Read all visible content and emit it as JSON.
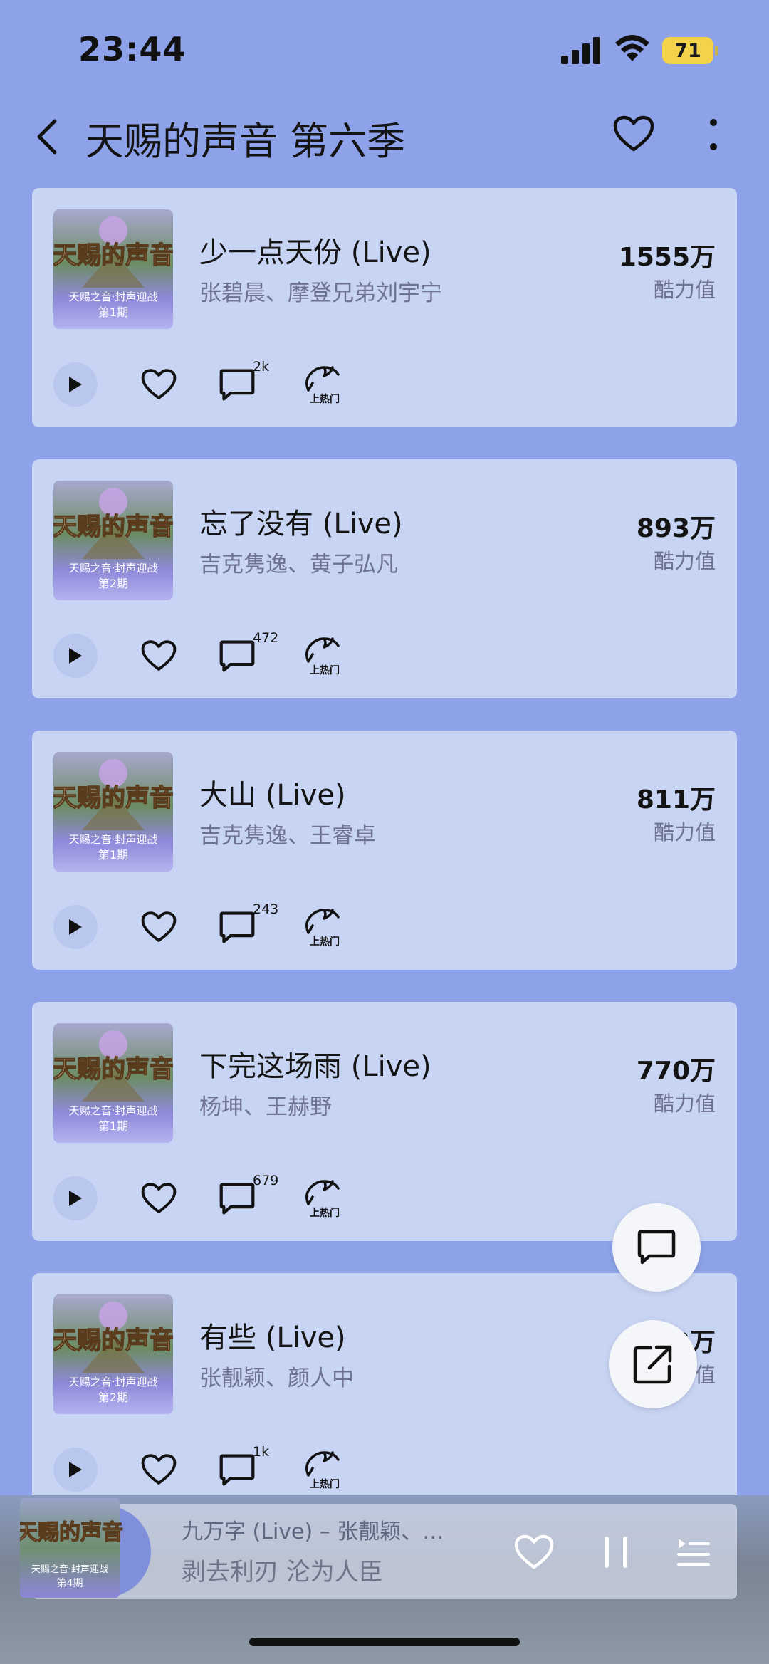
{
  "status": {
    "time": "23:44",
    "battery": "71"
  },
  "header": {
    "title": "天赐的声音 第六季"
  },
  "songs": [
    {
      "title": "少一点天份 (Live)",
      "artists": "张碧晨、摩登兄弟刘宇宁",
      "score": "1555万",
      "score_label": "酷力值",
      "comments": "2k",
      "hot_label": "上热门",
      "cover_badge": "第1期"
    },
    {
      "title": "忘了没有 (Live)",
      "artists": "吉克隽逸、黄子弘凡",
      "score": "893万",
      "score_label": "酷力值",
      "comments": "472",
      "hot_label": "上热门",
      "cover_badge": "第2期"
    },
    {
      "title": "大山 (Live)",
      "artists": "吉克隽逸、王睿卓",
      "score": "811万",
      "score_label": "酷力值",
      "comments": "243",
      "hot_label": "上热门",
      "cover_badge": "第1期"
    },
    {
      "title": "下完这场雨 (Live)",
      "artists": "杨坤、王赫野",
      "score": "770万",
      "score_label": "酷力值",
      "comments": "679",
      "hot_label": "上热门",
      "cover_badge": "第1期"
    },
    {
      "title": "有些 (Live)",
      "artists": "张靓颖、颜人中",
      "score": "612万",
      "score_label": "酷力值",
      "comments": "1k",
      "hot_label": "上热门",
      "cover_badge": "第2期"
    }
  ],
  "cover": {
    "logo": "天赐的声音",
    "subtitle": "天赐之音·封声迎战"
  },
  "player": {
    "title": "九万字 (Live) – 张靓颖、…",
    "lyric": "剥去利刃 沦为人臣",
    "cover_badge": "第4期"
  },
  "colors": {
    "background": "#8da2e9",
    "card": "#c7d4f3",
    "battery": "#f3d34a"
  }
}
